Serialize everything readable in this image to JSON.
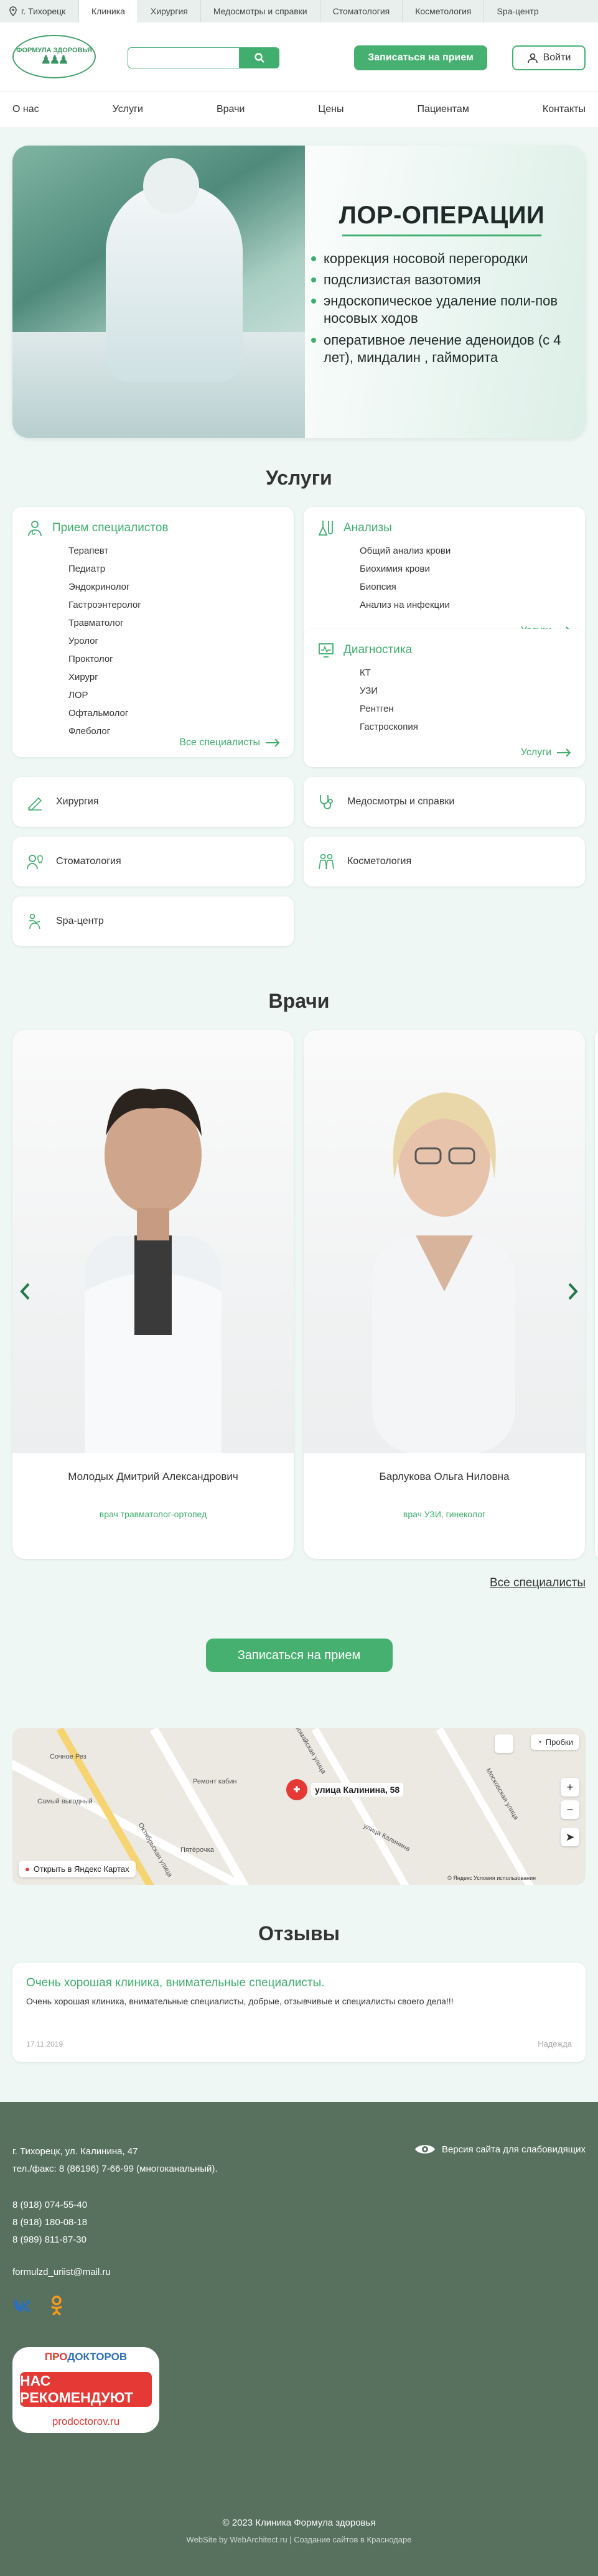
{
  "topbar": {
    "city": "г. Тихорецк",
    "tabs": [
      "Клиника",
      "Хирургия",
      "Медосмотры и справки",
      "Стоматология",
      "Косметология",
      "Spa-центр"
    ]
  },
  "header": {
    "logo_text": "ФОРМУЛА ЗДОРОВЬЯ",
    "search_placeholder": "",
    "book_label": "Записаться на прием",
    "login_label": "Войти"
  },
  "nav": [
    "О нас",
    "Услуги",
    "Врачи",
    "Цены",
    "Пациентам",
    "Контакты"
  ],
  "banner": {
    "title": "ЛОР-ОПЕРАЦИИ",
    "items": [
      "коррекция носовой перегородки",
      "подслизистая вазотомия",
      "эндоскопическое удаление поли-пов носовых ходов",
      "оперативное лечение аденоидов (с 4 лет), миндалин , гайморита"
    ]
  },
  "services": {
    "title": "Услуги",
    "specialists": {
      "heading": "Прием специалистов",
      "items": [
        "Терапевт",
        "Педиатр",
        "Эндокринолог",
        "Гастроэнтеролог",
        "Травматолог",
        "Уролог",
        "Проктолог",
        "Хирург",
        "ЛОР",
        "Офтальмолог",
        "Флеболог"
      ],
      "more": "Все специалисты"
    },
    "analyses": {
      "heading": "Анализы",
      "items": [
        "Общий анализ крови",
        "Биохимия крови",
        "Биопсия",
        "Анализ на инфекции"
      ],
      "more": "Услуги"
    },
    "diagnostics": {
      "heading": "Диагностика",
      "items": [
        "КТ",
        "УЗИ",
        "Рентген",
        "Гастроскопия"
      ],
      "more": "Услуги"
    },
    "small": [
      "Хирургия",
      "Медосмотры и справки",
      "Стоматология",
      "Косметология",
      "Spa-центр"
    ]
  },
  "doctors": {
    "title": "Врачи",
    "list": [
      {
        "name": "Молодых Дмитрий Александрович",
        "role": "врач травматолог-ортопед"
      },
      {
        "name": "Барлукова Ольга Ниловна",
        "role": "врач УЗИ, гинеколог"
      }
    ],
    "all_link": "Все специалисты",
    "book_label": "Записаться на прием"
  },
  "map": {
    "address": "улица Калинина, 58",
    "open_label": "Открыть в Яндекс Картах",
    "traffic_label": "Пробки",
    "copyright": "© Яндекс   Условия использования",
    "labels": [
      "Сочное Рез",
      "Самый выгодный",
      "Ремонт кабин",
      "Пятёрочка",
      "Первомайская улица",
      "Октябрьская улица",
      "улица Калинина",
      "Московская улица"
    ]
  },
  "reviews": {
    "title": "Отзывы",
    "items": [
      {
        "title": "Очень хорошая клиника, внимательные специалисты.",
        "text": "Очень хорошая клиника, внимательные специалисты, добрые, отзывчивые и специалисты своего дела!!!",
        "date": "17.11.2019",
        "author": "Надежда"
      }
    ]
  },
  "footer": {
    "address": "г. Тихорецк, ул. Калинина, 47",
    "phone_fax": "тел./факс: 8 (86196) 7-66-99 (многоканальный).",
    "phones": [
      "8 (918) 074-55-40",
      "8 (918) 180-08-18",
      "8 (989) 811-87-30"
    ],
    "email": "formulzd_uriist@mail.ru",
    "low_vision": "Версия сайта для слабовидящих",
    "badge": {
      "top": "ПРОДОКТОРОВ",
      "main": "НАС РЕКОМЕНДУЮТ",
      "site": "prodoctorov.ru"
    },
    "copyright": "© 2023 Клиника Формула здоровья",
    "dev": "WebSite by WebArchitect.ru | Создание сайтов в Краснодаре"
  },
  "colors": {
    "accent": "#46b071",
    "footer": "#58715f",
    "page_bg": "#eef7f4"
  }
}
